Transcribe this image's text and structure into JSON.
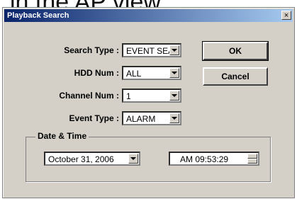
{
  "caption": "in the AP view.",
  "window": {
    "title": "Playback Search",
    "close_glyph": "×"
  },
  "fields": {
    "search_type": {
      "label": "Search Type :",
      "value": "EVENT SEA"
    },
    "hdd_num": {
      "label": "HDD Num :",
      "value": "ALL"
    },
    "channel_num": {
      "label": "Channel Num :",
      "value": "1"
    },
    "event_type": {
      "label": "Event Type :",
      "value": "ALARM"
    }
  },
  "buttons": {
    "ok": "OK",
    "cancel": "Cancel"
  },
  "datetime": {
    "group_label": "Date & Time",
    "date": "October 31, 2006",
    "time": "AM 09:53:29"
  }
}
